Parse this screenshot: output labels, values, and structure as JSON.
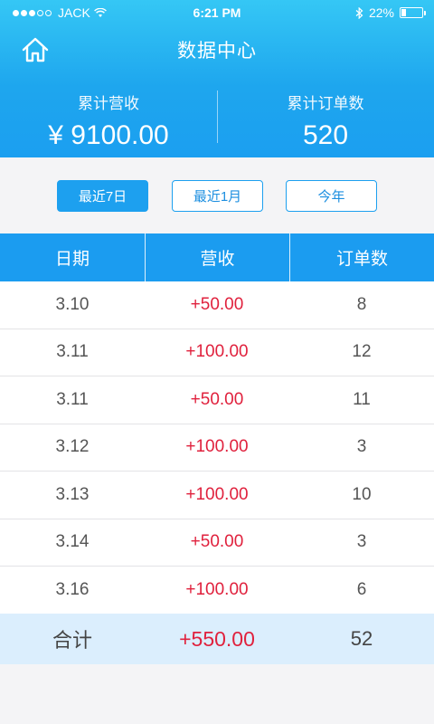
{
  "status_bar": {
    "carrier": "JACK",
    "time": "6:21 PM",
    "battery": "22%",
    "battery_level": 0.22
  },
  "nav": {
    "title": "数据中心",
    "home_icon": "home-icon"
  },
  "summary": {
    "revenue_label": "累计营收",
    "revenue_value": "¥ 9100.00",
    "orders_label": "累计订单数",
    "orders_value": "520"
  },
  "filters": [
    {
      "label": "最近7日",
      "active": true
    },
    {
      "label": "最近1月",
      "active": false
    },
    {
      "label": "今年",
      "active": false
    }
  ],
  "table": {
    "headers": [
      "日期",
      "营收",
      "订单数"
    ],
    "rows": [
      {
        "date": "3.10",
        "revenue": "+50.00",
        "orders": "8"
      },
      {
        "date": "3.11",
        "revenue": "+100.00",
        "orders": "12"
      },
      {
        "date": "3.11",
        "revenue": "+50.00",
        "orders": "11"
      },
      {
        "date": "3.12",
        "revenue": "+100.00",
        "orders": "3"
      },
      {
        "date": "3.13",
        "revenue": "+100.00",
        "orders": "10"
      },
      {
        "date": "3.14",
        "revenue": "+50.00",
        "orders": "3"
      },
      {
        "date": "3.16",
        "revenue": "+100.00",
        "orders": "6"
      }
    ],
    "total": {
      "label": "合计",
      "revenue": "+550.00",
      "orders": "52"
    }
  },
  "colors": {
    "accent": "#1b9cf0",
    "revenue_red": "#e0213d"
  }
}
